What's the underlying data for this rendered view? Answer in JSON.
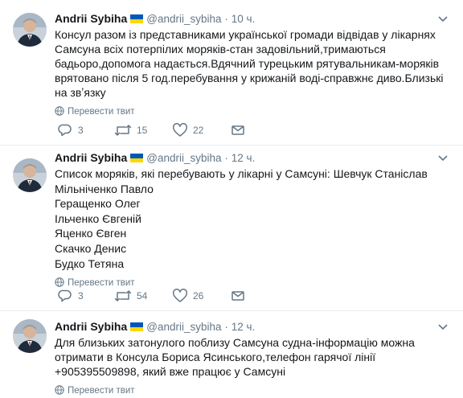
{
  "colors": {
    "muted": "#657786",
    "text": "#14171a",
    "divider": "#e6ecf0",
    "flag_blue": "#0057b7",
    "flag_yellow": "#ffd700"
  },
  "tweets": [
    {
      "author": "Andrii Sybiha",
      "handle": "@andrii_sybiha",
      "separator": "·",
      "time": "10 ч.",
      "text": "Консул разом із представниками української громади відвідав у лікарнях Самсуна всіх потерпілих моряків-стан задовільний,тримаються бадьоро,допомога надається.Вдячний турецьким рятувальникам-моряків врятовано після 5 год.перебування у крижаній воді-справжнє диво.Близькі на звʼязку",
      "translate": "Перевести твит",
      "replies": "3",
      "retweets": "15",
      "likes": "22"
    },
    {
      "author": "Andrii Sybiha",
      "handle": "@andrii_sybiha",
      "separator": "·",
      "time": "12 ч.",
      "lines": [
        "Список моряків, які перебувають у лікарні у Самсуні: Шевчук Станіслав",
        "Мільніченко Павло",
        "Геращенко Олег",
        "Ільченко Євгеній",
        "Яценко Євген",
        "Скачко Денис",
        "Будко Тетяна"
      ],
      "translate": "Перевести твит",
      "replies": "3",
      "retweets": "54",
      "likes": "26"
    },
    {
      "author": "Andrii Sybiha",
      "handle": "@andrii_sybiha",
      "separator": "·",
      "time": "12 ч.",
      "text": "Для близьких затонулого поблизу Самсуна судна-інформацію можна отримати в  Консула Бориса Ясинського,телефон гарячої лінії +905395509898, який вже працює у Самсуні",
      "translate": "Перевести твит"
    }
  ]
}
